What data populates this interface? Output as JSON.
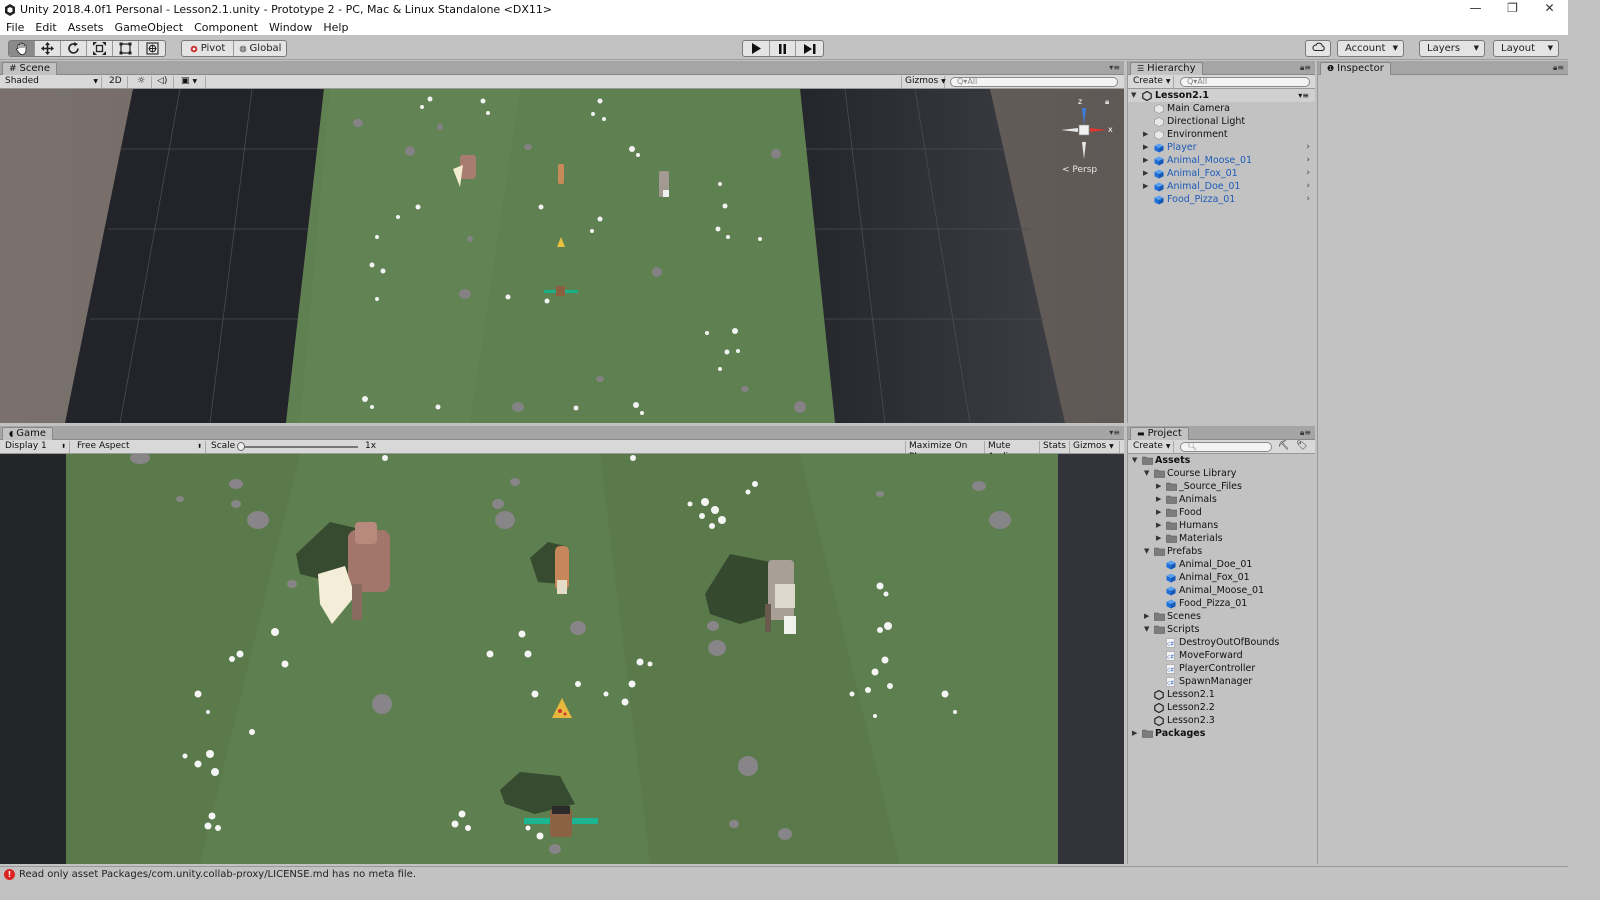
{
  "window": {
    "title": "Unity 2018.4.0f1 Personal - Lesson2.1.unity - Prototype 2 - PC, Mac & Linux Standalone <DX11>",
    "controls": {
      "minimize": "—",
      "maximize": "❐",
      "close": "✕"
    }
  },
  "menu": [
    "File",
    "Edit",
    "Assets",
    "GameObject",
    "Component",
    "Window",
    "Help"
  ],
  "toolbar": {
    "pivot": "Pivot",
    "global": "Global",
    "account": "Account",
    "layers": "Layers",
    "layout": "Layout"
  },
  "scene": {
    "tab": "Scene",
    "shading": "Shaded",
    "mode_2d": "2D",
    "gizmos": "Gizmos",
    "search_placeholder": "Q▾All",
    "persp": "< Persp",
    "axes": {
      "x": "x",
      "z": "z"
    }
  },
  "game": {
    "tab": "Game",
    "display": "Display 1",
    "aspect": "Free Aspect",
    "scale_label": "Scale",
    "scale_value": "1x",
    "maximize": "Maximize On Play",
    "mute": "Mute Audio",
    "stats": "Stats",
    "gizmos": "Gizmos"
  },
  "hierarchy": {
    "tab": "Hierarchy",
    "create": "Create",
    "search_placeholder": "Q▾All",
    "scene_name": "Lesson2.1",
    "items": [
      {
        "label": "Main Camera",
        "prefab": false,
        "expandable": false
      },
      {
        "label": "Directional Light",
        "prefab": false,
        "expandable": false
      },
      {
        "label": "Environment",
        "prefab": false,
        "expandable": true
      },
      {
        "label": "Player",
        "prefab": true,
        "expandable": true
      },
      {
        "label": "Animal_Moose_01",
        "prefab": true,
        "expandable": true
      },
      {
        "label": "Animal_Fox_01",
        "prefab": true,
        "expandable": true
      },
      {
        "label": "Animal_Doe_01",
        "prefab": true,
        "expandable": true
      },
      {
        "label": "Food_Pizza_01",
        "prefab": true,
        "expandable": false
      }
    ]
  },
  "inspector": {
    "tab": "Inspector"
  },
  "project": {
    "tab": "Project",
    "create": "Create",
    "tree": [
      {
        "label": "Assets",
        "depth": 0,
        "kind": "folder",
        "fold": "open",
        "bold": true
      },
      {
        "label": "Course Library",
        "depth": 1,
        "kind": "folder",
        "fold": "open"
      },
      {
        "label": "_Source_Files",
        "depth": 2,
        "kind": "folder",
        "fold": "closed"
      },
      {
        "label": "Animals",
        "depth": 2,
        "kind": "folder",
        "fold": "closed"
      },
      {
        "label": "Food",
        "depth": 2,
        "kind": "folder",
        "fold": "closed"
      },
      {
        "label": "Humans",
        "depth": 2,
        "kind": "folder",
        "fold": "closed"
      },
      {
        "label": "Materials",
        "depth": 2,
        "kind": "folder",
        "fold": "closed"
      },
      {
        "label": "Prefabs",
        "depth": 1,
        "kind": "folder",
        "fold": "open"
      },
      {
        "label": "Animal_Doe_01",
        "depth": 2,
        "kind": "prefab",
        "fold": "none"
      },
      {
        "label": "Animal_Fox_01",
        "depth": 2,
        "kind": "prefab",
        "fold": "none"
      },
      {
        "label": "Animal_Moose_01",
        "depth": 2,
        "kind": "prefab",
        "fold": "none"
      },
      {
        "label": "Food_Pizza_01",
        "depth": 2,
        "kind": "prefab",
        "fold": "none"
      },
      {
        "label": "Scenes",
        "depth": 1,
        "kind": "folder",
        "fold": "closed"
      },
      {
        "label": "Scripts",
        "depth": 1,
        "kind": "folder",
        "fold": "open"
      },
      {
        "label": "DestroyOutOfBounds",
        "depth": 2,
        "kind": "script",
        "fold": "none"
      },
      {
        "label": "MoveForward",
        "depth": 2,
        "kind": "script",
        "fold": "none"
      },
      {
        "label": "PlayerController",
        "depth": 2,
        "kind": "script",
        "fold": "none"
      },
      {
        "label": "SpawnManager",
        "depth": 2,
        "kind": "script",
        "fold": "none"
      },
      {
        "label": "Lesson2.1",
        "depth": 1,
        "kind": "scene",
        "fold": "none"
      },
      {
        "label": "Lesson2.2",
        "depth": 1,
        "kind": "scene",
        "fold": "none"
      },
      {
        "label": "Lesson2.3",
        "depth": 1,
        "kind": "scene",
        "fold": "none"
      },
      {
        "label": "Packages",
        "depth": 0,
        "kind": "folder",
        "fold": "closed",
        "bold": true
      }
    ]
  },
  "status": {
    "message": "Read only asset Packages/com.unity.collab-proxy/LICENSE.md has no meta file."
  },
  "colors": {
    "grass": "#5e7f4f",
    "road": "#24262b",
    "prefab_blue": "#1e6fd9",
    "error": "#d22222",
    "editor_bg": "#c2c2c2"
  }
}
